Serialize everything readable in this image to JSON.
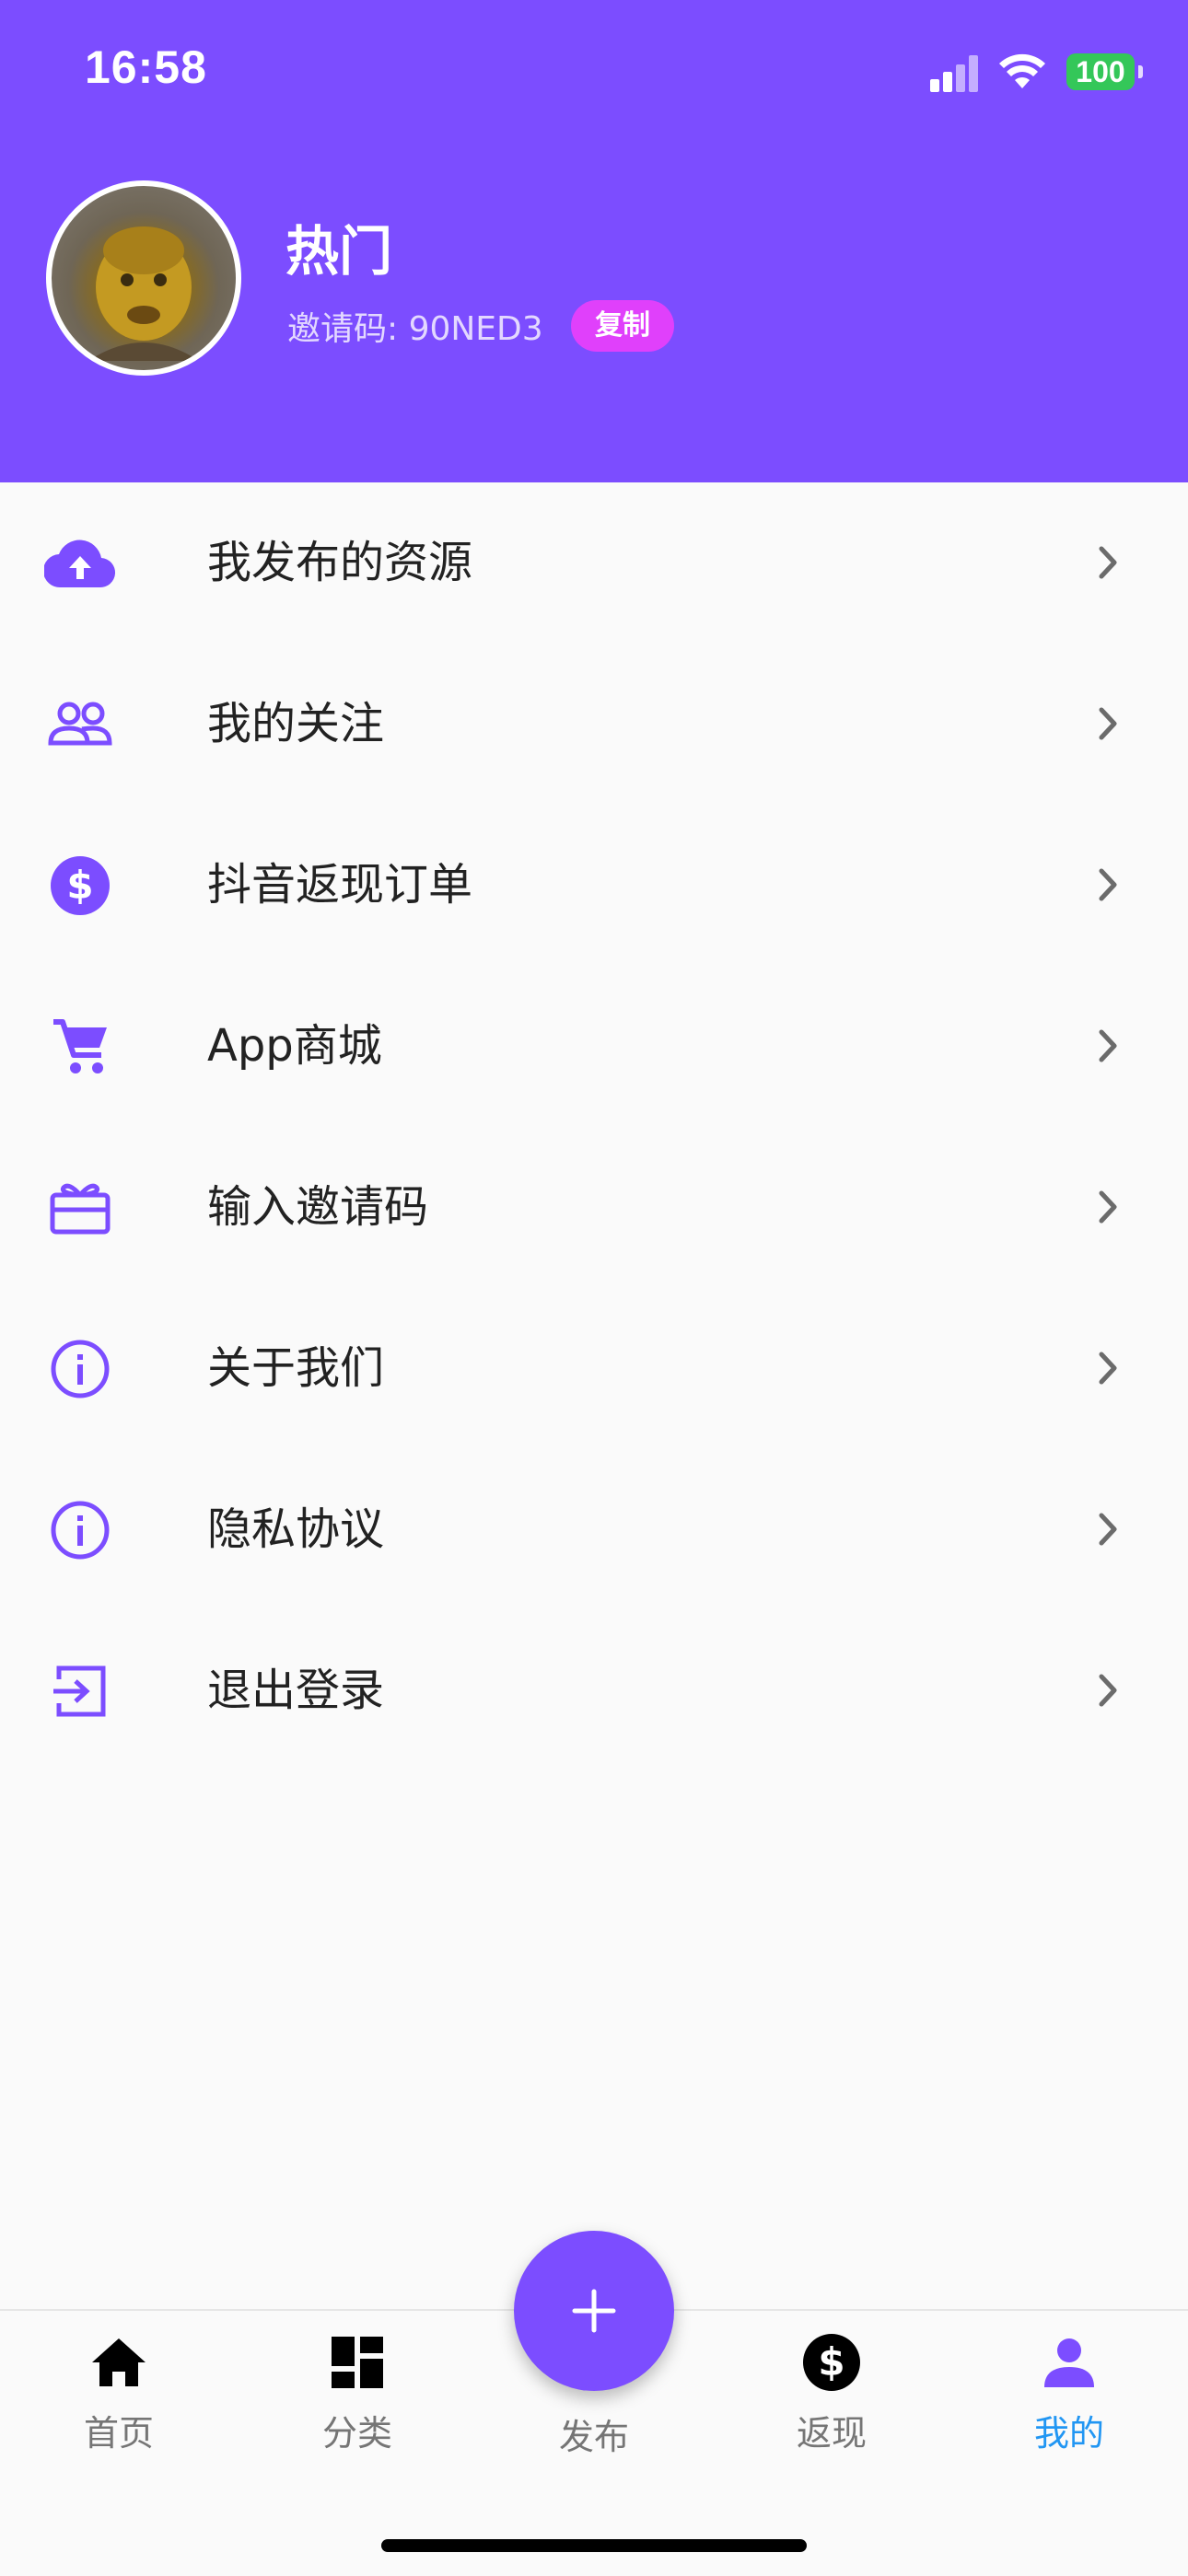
{
  "status_bar": {
    "time": "16:58",
    "battery": "100"
  },
  "profile": {
    "name": "热门",
    "invite_label": "邀请码: 90NED3",
    "copy_label": "复制"
  },
  "menu": {
    "items": [
      {
        "label": "我发布的资源",
        "icon": "cloud-upload-icon"
      },
      {
        "label": "我的关注",
        "icon": "people-icon"
      },
      {
        "label": "抖音返现订单",
        "icon": "dollar-circle-icon"
      },
      {
        "label": "App商城",
        "icon": "cart-icon"
      },
      {
        "label": "输入邀请码",
        "icon": "gift-card-icon"
      },
      {
        "label": "关于我们",
        "icon": "info-icon"
      },
      {
        "label": "隐私协议",
        "icon": "info-icon"
      },
      {
        "label": "退出登录",
        "icon": "logout-icon"
      }
    ]
  },
  "tabs": [
    {
      "label": "首页",
      "icon": "home-icon"
    },
    {
      "label": "分类",
      "icon": "dashboard-icon"
    },
    {
      "label": "发布",
      "icon": "plus-icon"
    },
    {
      "label": "返现",
      "icon": "dollar-circle-icon"
    },
    {
      "label": "我的",
      "icon": "person-icon",
      "active": true
    }
  ],
  "colors": {
    "primary": "#7c4dff",
    "accent": "#e040fb",
    "active_tab": "#2196f3"
  }
}
